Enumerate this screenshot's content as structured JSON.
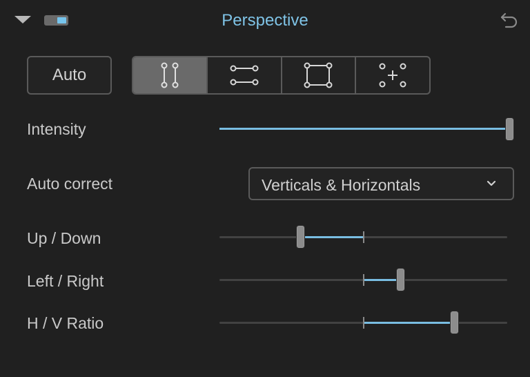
{
  "header": {
    "title": "Perspective",
    "toggle_on": true
  },
  "toolbar": {
    "auto_label": "Auto",
    "modes": [
      {
        "icon": "vertical-lines-icon",
        "active": true
      },
      {
        "icon": "horizontal-lines-icon",
        "active": false
      },
      {
        "icon": "rectangle-icon",
        "active": false
      },
      {
        "icon": "four-points-icon",
        "active": false
      }
    ]
  },
  "intensity": {
    "label": "Intensity",
    "value_fraction": 1.0
  },
  "auto_correct": {
    "label": "Auto correct",
    "selected": "Verticals & Horizontals"
  },
  "sliders": {
    "up_down": {
      "label": "Up / Down",
      "value_fraction": 0.28
    },
    "left_right": {
      "label": "Left / Right",
      "value_fraction": 0.625
    },
    "hv_ratio": {
      "label": "H / V Ratio",
      "value_fraction": 0.81
    }
  },
  "colors": {
    "accent": "#79bde2",
    "background": "#202020"
  }
}
